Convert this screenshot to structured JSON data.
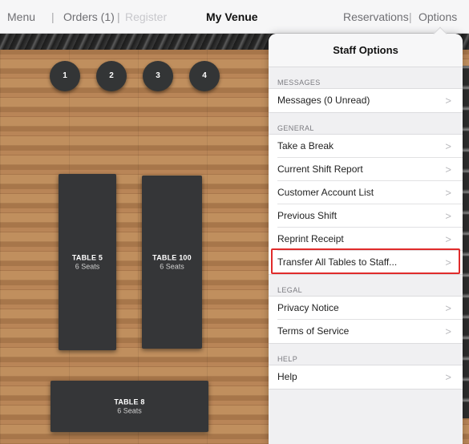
{
  "nav": {
    "menu": "Menu",
    "separator": "|",
    "orders": "Orders (1)",
    "register": "Register",
    "title": "My Venue",
    "reservations": "Reservations",
    "options": "Options"
  },
  "floor": {
    "seat_dots": [
      "1",
      "2",
      "3",
      "4"
    ],
    "tables": [
      {
        "name": "TABLE 5",
        "seats": "6 Seats"
      },
      {
        "name": "TABLE 100",
        "seats": "6 Seats"
      },
      {
        "name": "TABLE 8",
        "seats": "6 Seats"
      }
    ]
  },
  "staff_options": {
    "title": "Staff Options",
    "chevron": ">",
    "sections": [
      {
        "label": "MESSAGES",
        "items": [
          "Messages (0 Unread)"
        ]
      },
      {
        "label": "GENERAL",
        "items": [
          "Take a Break",
          "Current Shift Report",
          "Customer Account List",
          "Previous Shift",
          "Reprint Receipt",
          "Transfer All Tables to Staff..."
        ]
      },
      {
        "label": "LEGAL",
        "items": [
          "Privacy Notice",
          "Terms of Service"
        ]
      },
      {
        "label": "HELP",
        "items": [
          "Help"
        ]
      }
    ]
  },
  "colors": {
    "highlight_border": "#e02b2b",
    "table_fill": "#353638"
  }
}
